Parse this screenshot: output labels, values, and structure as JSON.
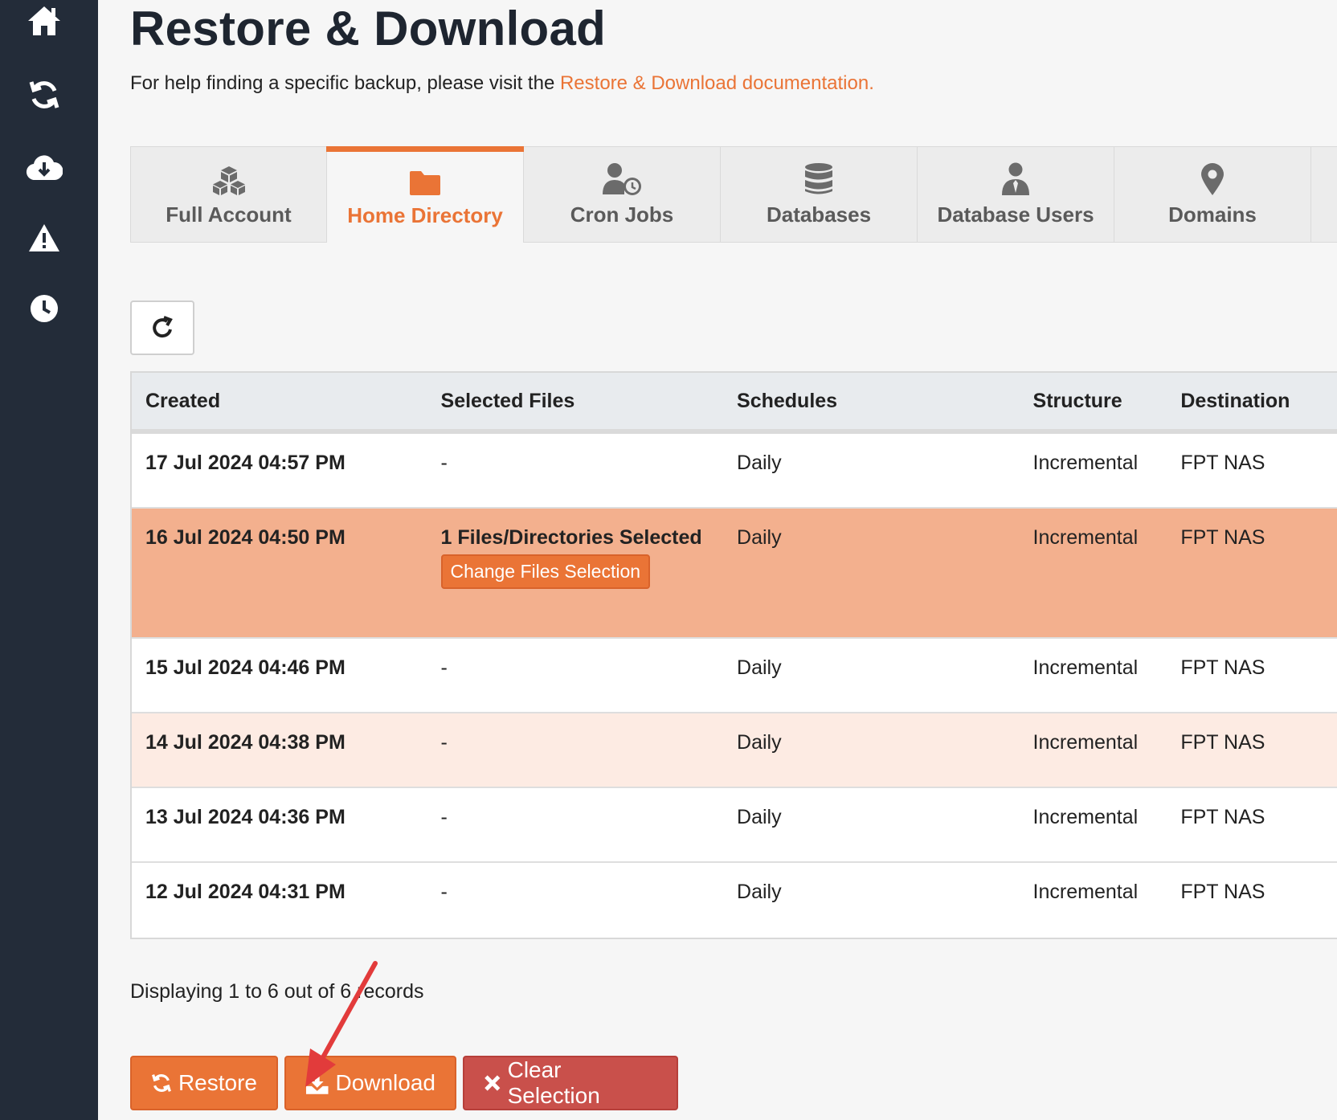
{
  "sidebar": {
    "icons": [
      "home-icon",
      "sync-icon",
      "cloud-download-icon",
      "warning-icon",
      "clock-icon"
    ]
  },
  "header": {
    "title": "Restore & Download",
    "help_text": "For help finding a specific backup, please visit the ",
    "help_link": "Restore & Download documentation."
  },
  "tabs": [
    {
      "label": "Full Account",
      "icon": "cubes-icon"
    },
    {
      "label": "Home Directory",
      "icon": "folder-icon",
      "active": true
    },
    {
      "label": "Cron Jobs",
      "icon": "user-clock-icon"
    },
    {
      "label": "Databases",
      "icon": "database-icon"
    },
    {
      "label": "Database Users",
      "icon": "user-tie-icon"
    },
    {
      "label": "Domains",
      "icon": "map-marker-icon"
    }
  ],
  "table": {
    "headers": [
      "Created",
      "Selected Files",
      "Schedules",
      "Structure",
      "Destination"
    ],
    "rows": [
      {
        "created": "17 Jul 2024 04:57 PM",
        "files": "-",
        "schedule": "Daily",
        "structure": "Incremental",
        "destination": "FPT NAS"
      },
      {
        "created": "16 Jul 2024 04:50 PM",
        "files": "1 Files/Directories Selected",
        "change_label": "Change Files Selection",
        "schedule": "Daily",
        "structure": "Incremental",
        "destination": "FPT NAS"
      },
      {
        "created": "15 Jul 2024 04:46 PM",
        "files": "-",
        "schedule": "Daily",
        "structure": "Incremental",
        "destination": "FPT NAS"
      },
      {
        "created": "14 Jul 2024 04:38 PM",
        "files": "-",
        "schedule": "Daily",
        "structure": "Incremental",
        "destination": "FPT NAS"
      },
      {
        "created": "13 Jul 2024 04:36 PM",
        "files": "-",
        "schedule": "Daily",
        "structure": "Incremental",
        "destination": "FPT NAS"
      },
      {
        "created": "12 Jul 2024 04:31 PM",
        "files": "-",
        "schedule": "Daily",
        "structure": "Incremental",
        "destination": "FPT NAS"
      }
    ]
  },
  "records_text": "Displaying 1 to 6 out of 6 records",
  "actions": {
    "restore": "Restore",
    "download": "Download",
    "clear": "Clear Selection"
  },
  "colors": {
    "accent": "#ea7436",
    "danger": "#c9504b",
    "sidebar": "#232c39",
    "selected_row": "#f3b08e"
  }
}
